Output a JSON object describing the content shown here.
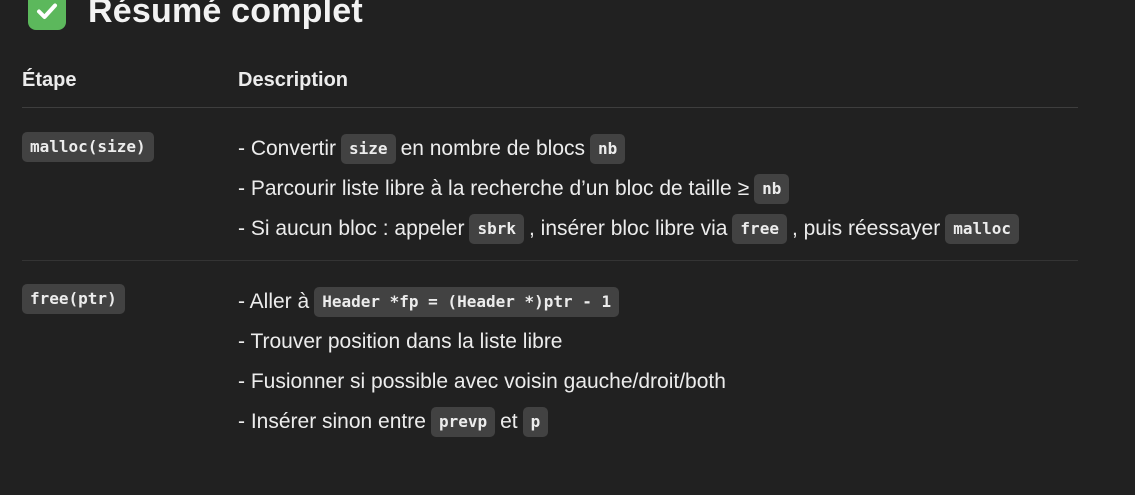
{
  "heading": {
    "icon": "check-mark-icon",
    "icon_color": "#5cb85c",
    "title": "Résumé complet"
  },
  "table": {
    "headers": {
      "step": "Étape",
      "description": "Description"
    },
    "rows": [
      {
        "step": "malloc(size)",
        "lines": [
          {
            "t0": "- Convertir",
            "c0": "size",
            "t1": "en nombre de blocs",
            "c1": "nb"
          },
          {
            "t0": "- Parcourir liste libre à la recherche d’un bloc de taille ≥",
            "c0": "nb"
          },
          {
            "t0": "- Si aucun bloc : appeler",
            "c0": "sbrk",
            "t1": ", insérer bloc libre via",
            "c1": "free",
            "t2": ", puis réessayer",
            "c2": "malloc"
          }
        ]
      },
      {
        "step": "free(ptr)",
        "lines": [
          {
            "t0": "- Aller à",
            "c0": "Header *fp = (Header *)ptr - 1"
          },
          {
            "t0": "- Trouver position dans la liste libre"
          },
          {
            "t0": "- Fusionner si possible avec voisin gauche/droit/both"
          },
          {
            "t0": "- Insérer sinon entre",
            "c0": "prevp",
            "t1": "et",
            "c1": "p"
          }
        ]
      }
    ]
  }
}
